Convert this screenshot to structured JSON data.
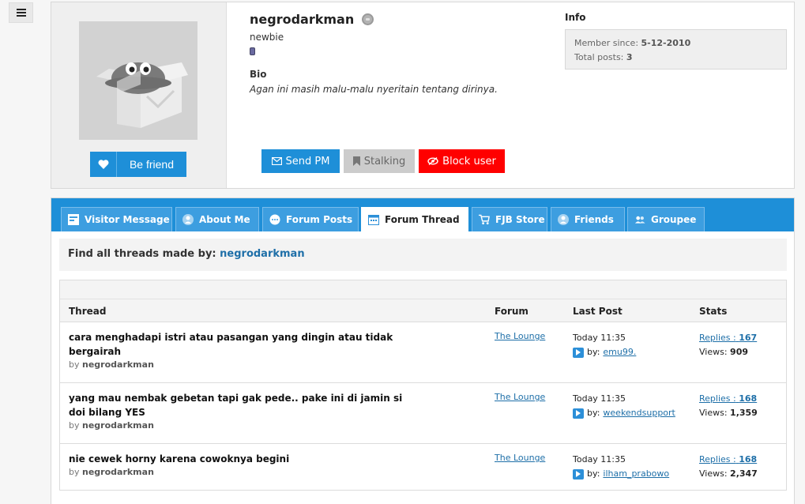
{
  "profile": {
    "username": "negrodarkman",
    "rank": "newbie",
    "bio_heading": "Bio",
    "bio": "Agan ini masih malu-malu nyeritain tentang dirinya.",
    "befriend_label": "Be friend",
    "actions": {
      "send_pm": "Send PM",
      "stalking": "Stalking",
      "block": "Block user"
    },
    "info": {
      "heading": "Info",
      "member_since_label": "Member since:",
      "member_since": "5-12-2010",
      "total_posts_label": "Total posts:",
      "total_posts": "3"
    }
  },
  "tabs": [
    {
      "label": "Visitor Message",
      "icon": "note-icon"
    },
    {
      "label": "About Me",
      "icon": "person-icon"
    },
    {
      "label": "Forum Posts",
      "icon": "speech-bubble-icon"
    },
    {
      "label": "Forum Thread",
      "icon": "calendar-icon",
      "active": true
    },
    {
      "label": "FJB Store",
      "icon": "cart-icon"
    },
    {
      "label": "Friends",
      "icon": "person-icon"
    },
    {
      "label": "Groupee",
      "icon": "people-icon"
    }
  ],
  "find": {
    "label": "Find all threads made by:",
    "user": "negrodarkman"
  },
  "table": {
    "headers": {
      "thread": "Thread",
      "forum": "Forum",
      "last_post": "Last Post",
      "stats": "Stats"
    },
    "by_prefix": "by",
    "last_by_prefix": "by:",
    "replies_label": "Replies :",
    "views_label": "Views:",
    "rows": [
      {
        "title": "cara menghadapi istri atau pasangan yang dingin atau tidak bergairah",
        "author": "negrodarkman",
        "forum": "The Lounge",
        "last_time": "Today 11:35",
        "last_by": "emu99.",
        "replies": "167",
        "views": "909"
      },
      {
        "title": "yang mau nembak gebetan tapi gak pede.. pake ini di jamin si doi bilang YES",
        "author": "negrodarkman",
        "forum": "The Lounge",
        "last_time": "Today 11:35",
        "last_by": "weekendsupport",
        "replies": "168",
        "views": "1,359"
      },
      {
        "title": "nie cewek horny karena cowoknya begini",
        "author": "negrodarkman",
        "forum": "The Lounge",
        "last_time": "Today 11:35",
        "last_by": "ilham_prabowo",
        "replies": "168",
        "views": "2,347"
      }
    ]
  },
  "colors": {
    "accent": "#1e8fd8",
    "block": "#ff0000",
    "link": "#1e6fa8"
  }
}
